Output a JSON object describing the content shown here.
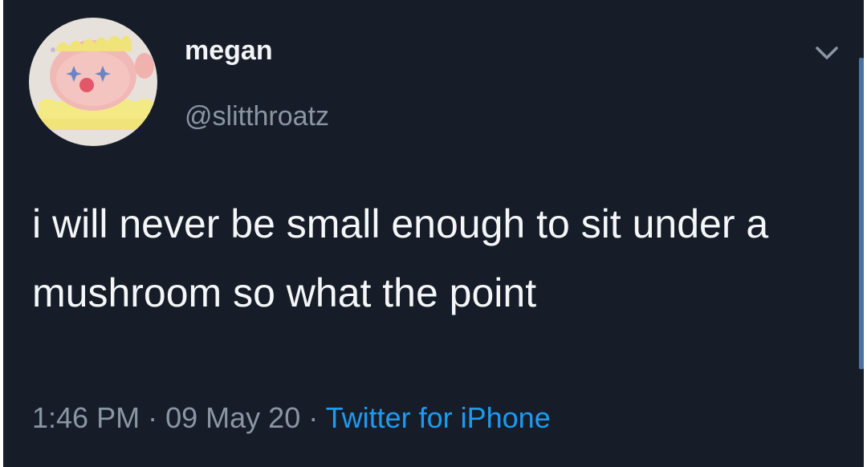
{
  "tweet": {
    "display_name": "megan",
    "handle": "@slitthroatz",
    "text": "i will never be small enough to sit under a mushroom so what the point",
    "time": "1:46 PM",
    "separator": "·",
    "date": "09 May 20",
    "source": "Twitter for iPhone"
  },
  "icons": {
    "avatar": "plush-clown-avatar",
    "menu": "chevron-down-icon"
  },
  "colors": {
    "background": "#171d28",
    "primary_text": "#f4f6f8",
    "secondary_text": "#8a96a3",
    "link": "#1d9bf0"
  }
}
